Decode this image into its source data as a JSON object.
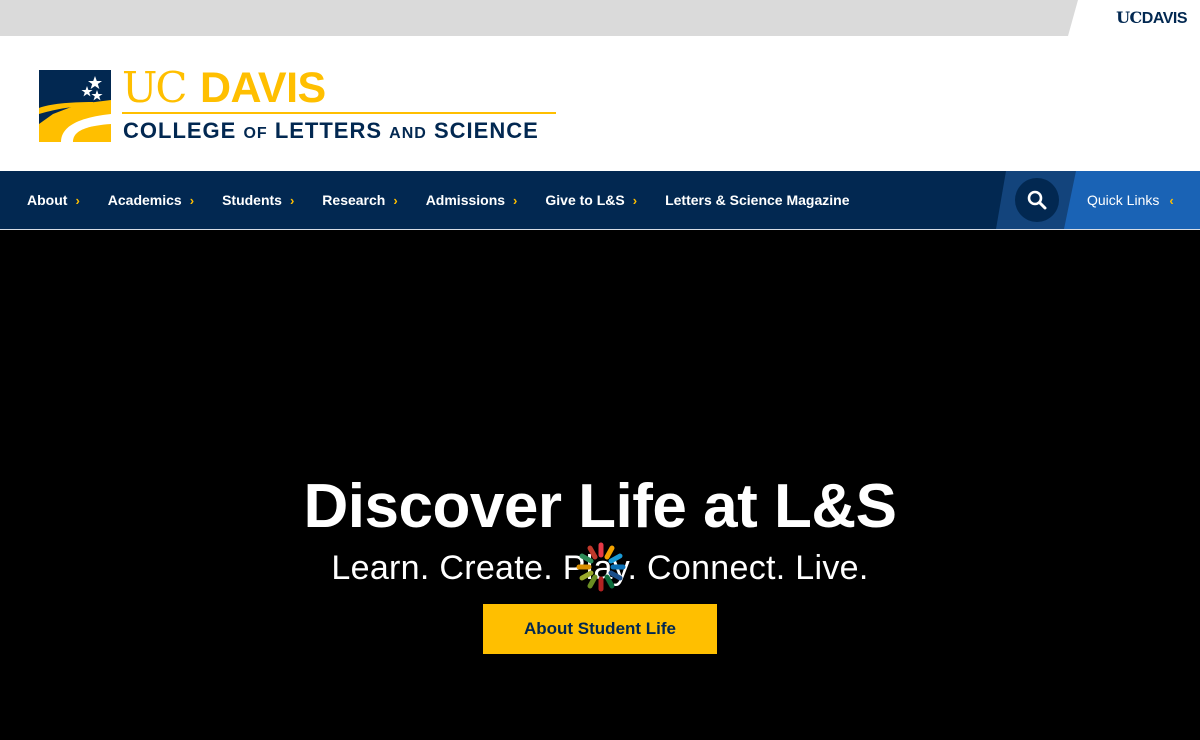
{
  "utility": {
    "logo_uc": "UC",
    "logo_davis": "DAVIS"
  },
  "branding": {
    "wordmark_uc": "UC",
    "wordmark_davis": "DAVIS",
    "college_word1": "COLLEGE",
    "college_of": "OF",
    "college_word2": "LETTERS",
    "college_and": "AND",
    "college_word3": "SCIENCE"
  },
  "nav": {
    "items": [
      {
        "label": "About",
        "has_chevron": true
      },
      {
        "label": "Academics",
        "has_chevron": true
      },
      {
        "label": "Students",
        "has_chevron": true
      },
      {
        "label": "Research",
        "has_chevron": true
      },
      {
        "label": "Admissions",
        "has_chevron": true
      },
      {
        "label": "Give to L&S",
        "has_chevron": true
      },
      {
        "label": "Letters & Science Magazine",
        "has_chevron": false
      }
    ],
    "quick_links_label": "Quick Links",
    "chevron_icon": "chevron-right-icon",
    "search_icon": "search-icon"
  },
  "hero": {
    "title": "Discover Life at L&S",
    "subtitle": "Learn. Create. Play. Connect. Live.",
    "cta_label": "About Student Life"
  },
  "colors": {
    "navy": "#022851",
    "gold": "#FFBF00",
    "quick_links_blue": "#1a63b5",
    "search_blue": "#13447c"
  }
}
